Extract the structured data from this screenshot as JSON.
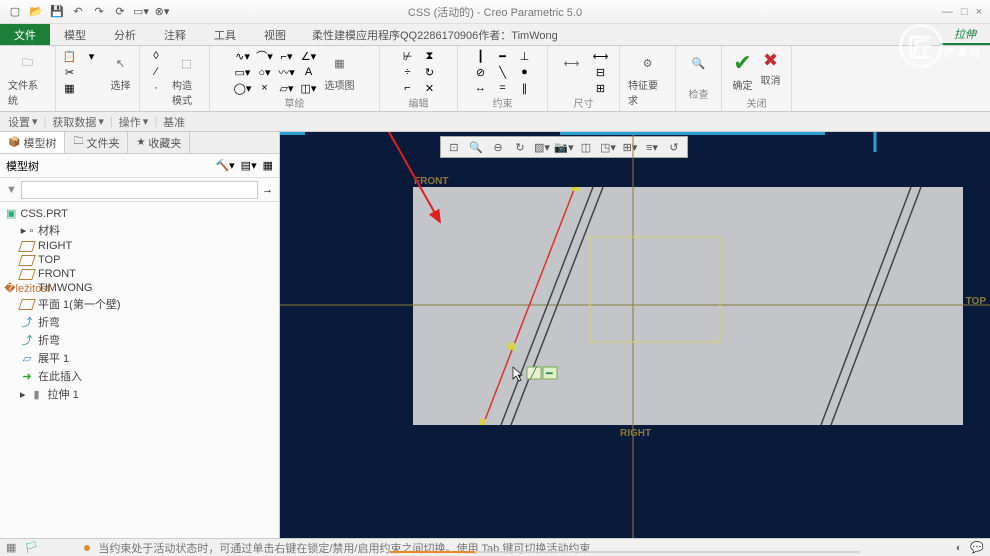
{
  "title": "CSS (活动的) - Creo Parametric 5.0",
  "menu": {
    "file": "文件",
    "tabs": [
      "模型",
      "分析",
      "注释",
      "工具",
      "视图"
    ],
    "ext": "柔性建模应用程序QQ2286170906作者：TimWong",
    "sketch": "拉伸"
  },
  "ribbon": {
    "groups": {
      "filesys": "文件系统",
      "select": "选择",
      "datum": "构造模式",
      "sketch": "草绘",
      "options": "选项图",
      "edit": "编辑",
      "constrain": "约束",
      "dim": "尺寸",
      "feat": "特征要求",
      "inspect": "检查",
      "ok": "确定",
      "cancel": "取消",
      "close": "关闭"
    },
    "settings": "设置",
    "getdata": "获取数据",
    "ops": "操作",
    "base": "基准"
  },
  "sidebar": {
    "tabs": {
      "model": "模型树",
      "files": "文件夹",
      "fav": "收藏夹"
    },
    "tree_label": "模型树",
    "root": "CSS.PRT",
    "items": [
      {
        "label": "材料",
        "icon": "material"
      },
      {
        "label": "RIGHT",
        "icon": "plane"
      },
      {
        "label": "TOP",
        "icon": "plane"
      },
      {
        "label": "FRONT",
        "icon": "plane"
      },
      {
        "label": "TIMWONG",
        "icon": "csys"
      },
      {
        "label": "平面 1(第一个壁)",
        "icon": "plane"
      },
      {
        "label": "折弯",
        "icon": "bend"
      },
      {
        "label": "折弯",
        "icon": "bend"
      },
      {
        "label": "展平 1",
        "icon": "flat"
      },
      {
        "label": "在此插入",
        "icon": "insert"
      },
      {
        "label": "拉伸 1",
        "icon": "extrude"
      }
    ]
  },
  "datum": {
    "front": "FRONT",
    "top": "TOP",
    "right": "RIGHT"
  },
  "status": {
    "text": "当约束处于活动状态时，可通过单击右键在锁定/禁用/启用约束之间切换。使用 Tab 键可切换活动约束"
  },
  "watermark": "虎课网"
}
